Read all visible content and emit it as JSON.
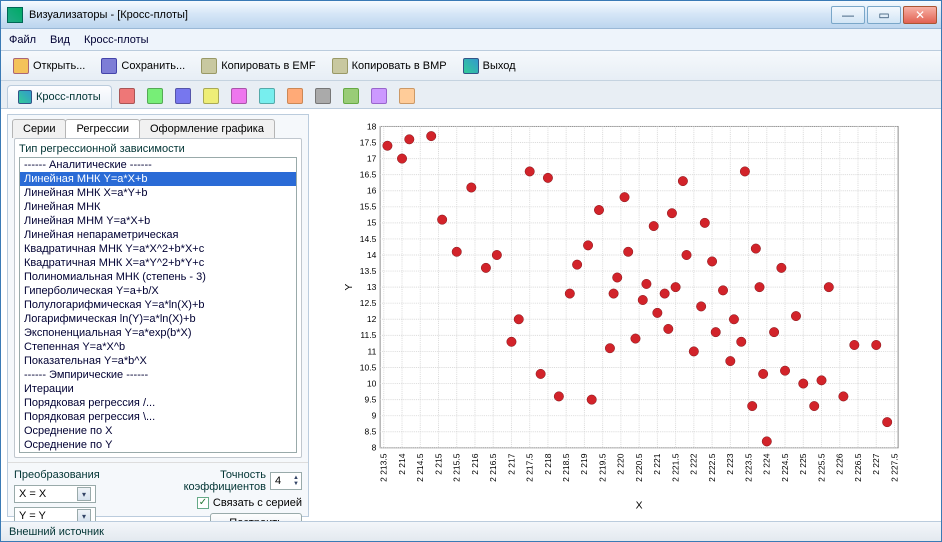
{
  "window": {
    "title": "Визуализаторы - [Кросс-плоты]"
  },
  "menu": {
    "file": "Файл",
    "view": "Вид",
    "crossplots": "Кросс-плоты"
  },
  "toolbar": {
    "open": "Открыть...",
    "save": "Сохранить...",
    "copy_emf": "Копировать в EMF",
    "copy_bmp": "Копировать в BMP",
    "exit": "Выход"
  },
  "tabs": {
    "main": "Кросс-плоты",
    "sub_series": "Серии",
    "sub_regressions": "Регрессии",
    "sub_style": "Оформление графика"
  },
  "regression_group_label": "Тип регрессионной зависимости",
  "regression_items": [
    "------ Аналитические ------",
    "Линейная МНК Y=a*X+b",
    "Линейная МНК X=a*Y+b",
    "Линейная МНК",
    "Линейная МНМ Y=a*X+b",
    "Линейная непараметрическая",
    "Квадратичная МНК Y=a*X^2+b*X+c",
    "Квадратичная МНК X=a*Y^2+b*Y+c",
    "Полиномиальная МНК (степень - 3)",
    "Гиперболическая Y=a+b/X",
    "Полулогарифмическая Y=a*ln(X)+b",
    "Логарифмическая ln(Y)=a*ln(X)+b",
    "Экспоненциальная Y=a*exp(b*X)",
    "Степенная Y=a*X^b",
    "Показательная Y=a*b^X",
    "------ Эмпирические ------",
    "Итерации",
    "Порядковая регрессия /...",
    "Порядковая регрессия \\...",
    "Осреднение по X",
    "Осреднение по Y"
  ],
  "regression_selected_index": 1,
  "controls": {
    "transforms_label": "Преобразования",
    "precision_label": "Точность коэффициентов",
    "precision_value": "4",
    "x_transform": "X = X",
    "y_transform": "Y = Y",
    "link_series": "Связать с серией",
    "build_btn": "Построить"
  },
  "statusbar": "Внешний источник",
  "chart_data": {
    "type": "scatter",
    "title": "",
    "xlabel": "X",
    "ylabel": "Y",
    "xlim": [
      2213.4,
      2227.6
    ],
    "ylim": [
      8,
      18
    ],
    "y_ticks": [
      8,
      8.5,
      9,
      9.5,
      10,
      10.5,
      11,
      11.5,
      12,
      12.5,
      13,
      13.5,
      14,
      14.5,
      15,
      15.5,
      16,
      16.5,
      17,
      17.5,
      18
    ],
    "x_ticks": [
      "2 213.5",
      "2 214",
      "2 214.5",
      "2 215",
      "2 215.5",
      "2 216",
      "2 216.5",
      "2 217",
      "2 217.5",
      "2 218",
      "2 218.5",
      "2 219",
      "2 219.5",
      "2 220",
      "2 220.5",
      "2 221",
      "2 221.5",
      "2 222",
      "2 222.5",
      "2 223",
      "2 223.5",
      "2 224",
      "2 224.5",
      "2 225",
      "2 225.5",
      "2 226",
      "2 226.5",
      "2 227",
      "2 227.5"
    ],
    "x_tick_values": [
      2213.5,
      2214,
      2214.5,
      2215,
      2215.5,
      2216,
      2216.5,
      2217,
      2217.5,
      2218,
      2218.5,
      2219,
      2219.5,
      2220,
      2220.5,
      2221,
      2221.5,
      2222,
      2222.5,
      2223,
      2223.5,
      2224,
      2224.5,
      2225,
      2225.5,
      2226,
      2226.5,
      2227,
      2227.5
    ],
    "series": [
      {
        "name": "",
        "color": "#d2232a",
        "points": [
          [
            2213.6,
            17.4
          ],
          [
            2214.0,
            17.0
          ],
          [
            2214.2,
            17.6
          ],
          [
            2214.8,
            17.7
          ],
          [
            2215.1,
            15.1
          ],
          [
            2215.5,
            14.1
          ],
          [
            2215.9,
            16.1
          ],
          [
            2216.3,
            13.6
          ],
          [
            2216.6,
            14.0
          ],
          [
            2217.0,
            11.3
          ],
          [
            2217.2,
            12.0
          ],
          [
            2217.5,
            16.6
          ],
          [
            2217.8,
            10.3
          ],
          [
            2218.0,
            16.4
          ],
          [
            2218.3,
            9.6
          ],
          [
            2218.6,
            12.8
          ],
          [
            2218.8,
            13.7
          ],
          [
            2219.2,
            9.5
          ],
          [
            2219.1,
            14.3
          ],
          [
            2219.4,
            15.4
          ],
          [
            2219.8,
            12.8
          ],
          [
            2219.9,
            13.3
          ],
          [
            2219.7,
            11.1
          ],
          [
            2220.1,
            15.8
          ],
          [
            2220.2,
            14.1
          ],
          [
            2220.4,
            11.4
          ],
          [
            2220.6,
            12.6
          ],
          [
            2220.7,
            13.1
          ],
          [
            2220.9,
            14.9
          ],
          [
            2221.0,
            12.2
          ],
          [
            2221.2,
            12.8
          ],
          [
            2221.3,
            11.7
          ],
          [
            2221.5,
            13.0
          ],
          [
            2221.4,
            15.3
          ],
          [
            2221.7,
            16.3
          ],
          [
            2221.8,
            14.0
          ],
          [
            2222.0,
            11.0
          ],
          [
            2222.2,
            12.4
          ],
          [
            2222.3,
            15.0
          ],
          [
            2222.5,
            13.8
          ],
          [
            2222.6,
            11.6
          ],
          [
            2222.8,
            12.9
          ],
          [
            2223.0,
            10.7
          ],
          [
            2223.1,
            12.0
          ],
          [
            2223.4,
            16.6
          ],
          [
            2223.3,
            11.3
          ],
          [
            2223.6,
            9.3
          ],
          [
            2223.7,
            14.2
          ],
          [
            2223.8,
            13.0
          ],
          [
            2223.9,
            10.3
          ],
          [
            2224.0,
            8.2
          ],
          [
            2224.2,
            11.6
          ],
          [
            2224.4,
            13.6
          ],
          [
            2224.5,
            10.4
          ],
          [
            2224.8,
            12.1
          ],
          [
            2225.0,
            10.0
          ],
          [
            2225.5,
            10.1
          ],
          [
            2225.3,
            9.3
          ],
          [
            2225.7,
            13.0
          ],
          [
            2226.1,
            9.6
          ],
          [
            2226.4,
            11.2
          ],
          [
            2227.0,
            11.2
          ],
          [
            2227.3,
            8.8
          ]
        ]
      }
    ]
  }
}
